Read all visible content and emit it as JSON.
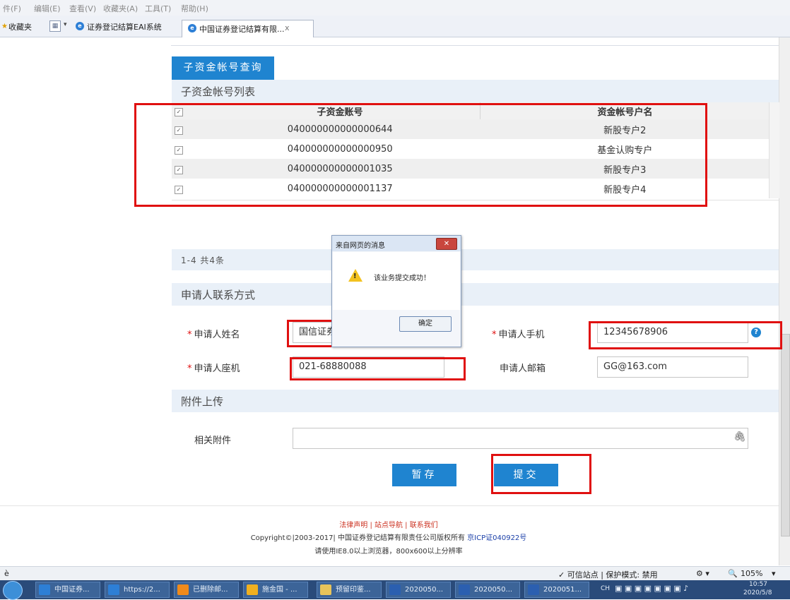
{
  "menu": [
    "件(F)",
    "编辑(E)",
    "查看(V)",
    "收藏夹(A)",
    "工具(T)",
    "帮助(H)"
  ],
  "favorites": {
    "label": "收藏夹",
    "tab1": "证券登记结算EAI系统",
    "tab2": "中国证券登记结算有限...",
    "tab2_close": "x"
  },
  "query_tab": "子资金帐号查询",
  "list_title": "子资金帐号列表",
  "table": {
    "headers": [
      "子资金账号",
      "资金帐号户名"
    ],
    "rows": [
      {
        "account": "040000000000000644",
        "name": "新股专户2"
      },
      {
        "account": "040000000000000950",
        "name": "基金认购专户"
      },
      {
        "account": "040000000000001035",
        "name": "新股专户3"
      },
      {
        "account": "040000000000001137",
        "name": "新股专户4"
      }
    ]
  },
  "pager": "1-4  共4条",
  "contact": {
    "title": "申请人联系方式",
    "name_label": "申请人姓名",
    "name_value": "国信证券",
    "phone_label": "申请人手机",
    "phone_value": "12345678906",
    "landline_label": "申请人座机",
    "landline_value": "021-68880088",
    "email_label": "申请人邮箱",
    "email_value": "GG@163.com",
    "required_mark": "*",
    "help": "?"
  },
  "attachment": {
    "title": "附件上传",
    "label": "相关附件",
    "clip": "🖇"
  },
  "buttons": {
    "save": "暂存",
    "submit": "提交"
  },
  "dialog": {
    "title": "来自网页的消息",
    "close": "✕",
    "message": "该业务提交成功！",
    "ok": "确定"
  },
  "footer": {
    "links": "法律声明 | 站点导航 | 联系我们",
    "copyright_prefix": "Copyright©|2003-2017| 中国证券登记结算有限责任公司版权所有 ",
    "icp": "京ICP证040922号",
    "browser_note": "请使用IE8.0以上浏览器，800x600以上分辨率"
  },
  "status": {
    "left": "è",
    "trusted": "✓ 可信站点 | 保护模式: 禁用",
    "zoom": "105%"
  },
  "taskbar": {
    "items": [
      "中国证券...",
      "https://2...",
      "已删除邮...",
      "施金国 - ...",
      "预留印鉴...",
      "2020050...",
      "2020050...",
      "2020051..."
    ],
    "lang": "CH",
    "time": "10:57",
    "date": "2020/5/8"
  },
  "colors": {
    "accent": "#1f84d0",
    "highlight_red": "#e01010",
    "section_bg": "#e9f0f8"
  }
}
